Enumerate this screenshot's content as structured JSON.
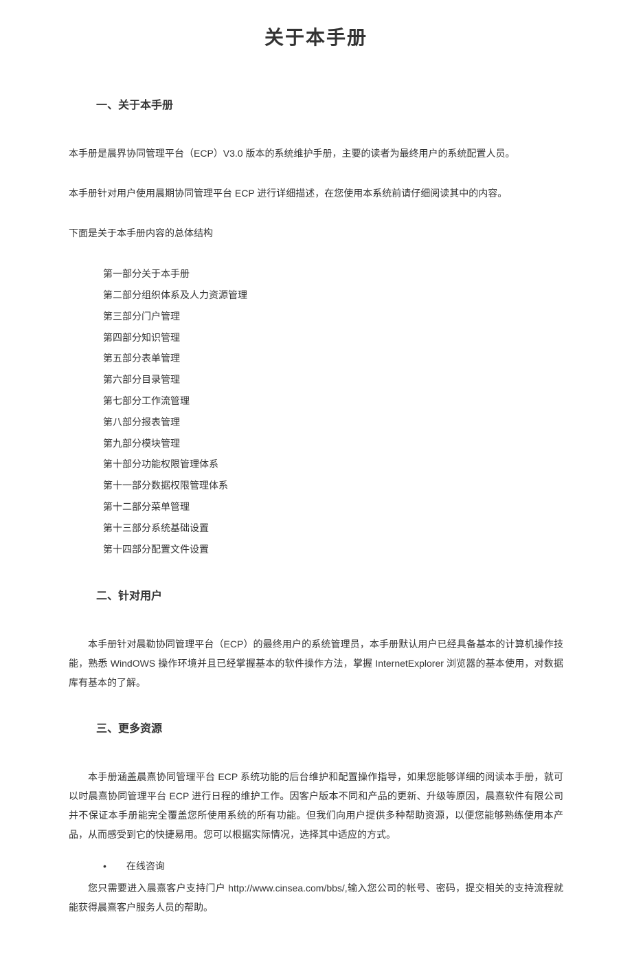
{
  "page_title": "关于本手册",
  "section1": {
    "heading": "一、关于本手册",
    "para1": "本手册是晨界协同管理平台（ECP）V3.0 版本的系统维护手册，主要的读者为最终用户的系统配置人员。",
    "para2": "本手册针对用户使用晨期协同管理平台 ECP 进行详细描述，在您使用本系统前请仔细阅读其中的内容。",
    "para3": "下面是关于本手册内容的总体结构",
    "toc": [
      "第一部分关于本手册",
      "第二部分组织体系及人力资源管理",
      "第三部分门户管理",
      "第四部分知识管理",
      "第五部分表单管理",
      "第六部分目录管理",
      "第七部分工作流管理",
      "第八部分报表管理",
      "第九部分模块管理",
      "第十部分功能权限管理体系",
      "第十一部分数据权限管理体系",
      "第十二部分菜单管理",
      "第十三部分系统基础设置",
      "第十四部分配置文件设置"
    ]
  },
  "section2": {
    "heading": "二、针对用户",
    "para1": "本手册针对晨勒协同管理平台（ECP）的最终用户的系统管理员，本手册默认用户已经具备基本的计算机操作技能，熟悉 WindOWS 操作环境并且已经掌握基本的软件操作方法，掌握 InternetExplorer 浏览器的基本使用，对数据库有基本的了解。"
  },
  "section3": {
    "heading": "三、更多资源",
    "para1": "本手册涵盖晨熹协同管理平台 ECP 系统功能的后台维护和配置操作指导，如果您能够详细的阅读本手册，就可以时晨熹协同管理平台 ECP 进行日程的维护工作。因客户版本不同和产品的更新、升级等原因，晨熹软件有限公司并不保证本手册能完全覆盖您所使用系统的所有功能。但我们向用户提供多种帮助资源，以便您能够熟练使用本产品，从而感受到它的快捷易用。您可以根据实际情况，选择其中适应的方式。",
    "bullet1_label": "在线咨询",
    "bullet1_text": "您只需要进入晨熹客户支持门户 http://www.cinsea.com/bbs/,输入您公司的帐号、密码，提交相关的支持流程就能获得晨熹客户服务人员的帮助。"
  }
}
